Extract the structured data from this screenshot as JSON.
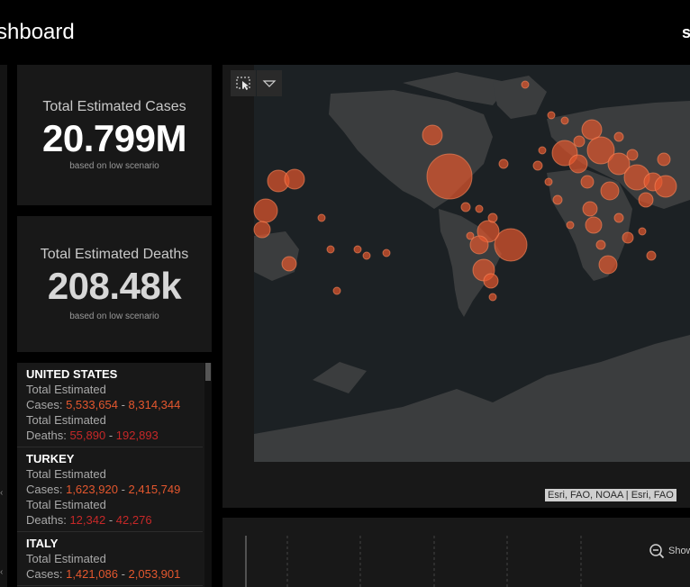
{
  "header": {
    "title": "shboard",
    "right_fragment": "s"
  },
  "stats": {
    "cases": {
      "title": "Total Estimated Cases",
      "value": "20.799M",
      "subtitle": "based on low scenario"
    },
    "deaths": {
      "title": "Total Estimated Deaths",
      "value": "208.48k",
      "subtitle": "based on low scenario"
    }
  },
  "countries": [
    {
      "name": "UNITED STATES",
      "label1": "Total Estimated",
      "cases_label": "Cases:",
      "cases_low": "5,533,654",
      "cases_high": "8,314,344",
      "label2": "Total Estimated",
      "deaths_label": "Deaths:",
      "deaths_low": "55,890",
      "deaths_high": "192,893",
      "sep": "-"
    },
    {
      "name": "TURKEY",
      "label1": "Total Estimated",
      "cases_label": "Cases:",
      "cases_low": "1,623,920",
      "cases_high": "2,415,749",
      "label2": "Total Estimated",
      "deaths_label": "Deaths:",
      "deaths_low": "12,342",
      "deaths_high": "42,276",
      "sep": "-"
    },
    {
      "name": "ITALY",
      "label1": "Total Estimated",
      "cases_label": "Cases:",
      "cases_low": "1,421,086",
      "cases_high": "2,053,901",
      "sep": "-"
    }
  ],
  "map": {
    "attribution": "Esri, FAO, NOAA | Esri, FAO",
    "tools": [
      "select-icon",
      "chevron-down-icon"
    ],
    "colors": {
      "ocean": "#1c2124",
      "land": "#3b3d3e",
      "marker": "#e4572e"
    }
  },
  "bottom": {
    "zoom_label": "Show"
  },
  "left_strip": {
    "marks": [
      "‹",
      "‹"
    ]
  }
}
